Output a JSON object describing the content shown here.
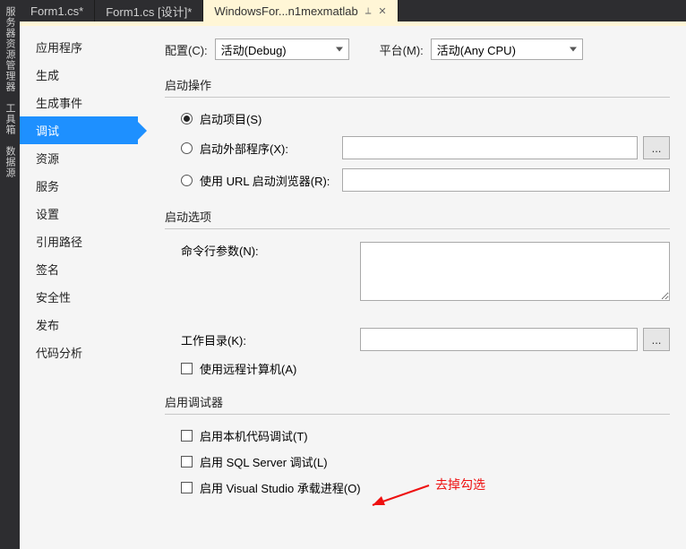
{
  "rail": {
    "items": [
      "服务器资源管理器",
      "工具箱",
      "数据源"
    ]
  },
  "tabs": [
    {
      "label": "Form1.cs*"
    },
    {
      "label": "Form1.cs [设计]*"
    },
    {
      "label": "WindowsFor...n1mexmatlab"
    }
  ],
  "nav": {
    "items": [
      "应用程序",
      "生成",
      "生成事件",
      "调试",
      "资源",
      "服务",
      "设置",
      "引用路径",
      "签名",
      "安全性",
      "发布",
      "代码分析"
    ],
    "selectedIndex": 3
  },
  "top": {
    "config_label": "配置(C):",
    "config_value": "活动(Debug)",
    "platform_label": "平台(M):",
    "platform_value": "活动(Any CPU)"
  },
  "sections": {
    "startup": {
      "title": "启动操作",
      "radios": [
        {
          "label": "启动项目(S)",
          "checked": true
        },
        {
          "label": "启动外部程序(X):",
          "checked": false,
          "hasField": true,
          "hasBrowse": true
        },
        {
          "label": "使用 URL 启动浏览器(R):",
          "checked": false,
          "hasField": true
        }
      ]
    },
    "options": {
      "title": "启动选项",
      "cmdline_label": "命令行参数(N):",
      "workdir_label": "工作目录(K):",
      "remote_label": "使用远程计算机(A)"
    },
    "debugger": {
      "title": "启用调试器",
      "checks": [
        "启用本机代码调试(T)",
        "启用 SQL Server 调试(L)",
        "启用 Visual Studio 承载进程(O)"
      ]
    }
  },
  "annotation": "去掉勾选",
  "browse_label": "..."
}
